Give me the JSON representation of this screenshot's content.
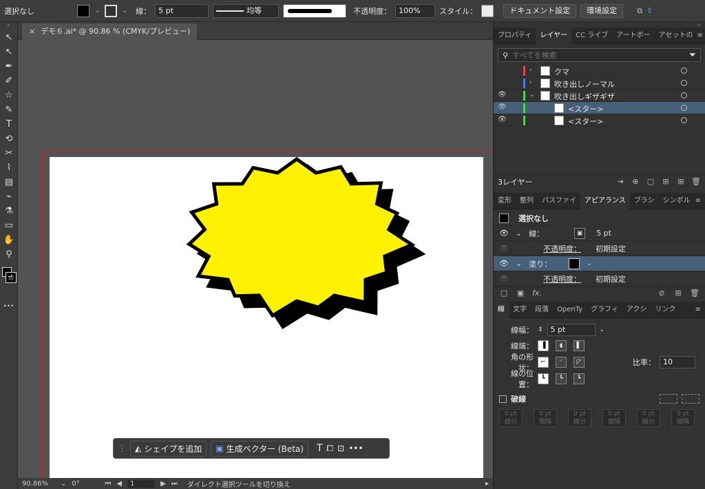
{
  "control_bar": {
    "selection": "選択なし",
    "stroke_label": "線：",
    "stroke_weight": "5 pt",
    "profile": "均等",
    "opacity_label": "不透明度：",
    "opacity": "100%",
    "style_label": "スタイル：",
    "doc_settings": "ドキュメント設定",
    "env_settings": "環境設定"
  },
  "document_tab": {
    "close": "×",
    "title": "デモ６.ai* @ 90.86 % (CMYK/プレビュー)"
  },
  "toolbar": {
    "icons": [
      "selection-tool-icon",
      "direct-selection-tool-icon",
      "pen-tool-icon",
      "curvature-tool-icon",
      "star-tool-icon",
      "paintbrush-tool-icon",
      "type-tool-icon",
      "rotate-tool-icon",
      "scissors-tool-icon",
      "warp-tool-icon",
      "gradient-tool-icon",
      "eyedropper-tool-icon",
      "symbol-sprayer-icon",
      "artboard-tool-icon",
      "hand-tool-icon",
      "zoom-tool-icon"
    ],
    "glyphs": [
      "↖",
      "↖",
      "✒",
      "✐",
      "☆",
      "✎",
      "T",
      "⟲",
      "✂",
      "⌇",
      "▤",
      "⌁",
      "⚗",
      "▭",
      "✋",
      "⚲"
    ],
    "more": "•••"
  },
  "contextual_task_bar": {
    "add_shape": "シェイプを追加",
    "gen_vector": "生成ベクター (Beta)"
  },
  "status_bar": {
    "zoom": "90.86%",
    "rotation": "0°",
    "artboard": "1",
    "message": "ダイレクト選択ツールを切り換え"
  },
  "layers_panel": {
    "tabs": [
      "プロパティ",
      "レイヤー",
      "CC ライブ",
      "アートボー",
      "アセットの"
    ],
    "active_tab": 1,
    "search_placeholder": "すべてを検索",
    "rows": [
      {
        "name": "クマ",
        "visible": false,
        "color": "#e0474c",
        "indent": 0,
        "chevron": "›",
        "selected": false
      },
      {
        "name": "吹き出しノーマル",
        "visible": false,
        "color": "#4f7bd6",
        "indent": 0,
        "chevron": "›",
        "selected": false
      },
      {
        "name": "吹き出しギザギザ",
        "visible": true,
        "color": "#4fd14f",
        "indent": 0,
        "chevron": "⌄",
        "selected": false
      },
      {
        "name": "<スター>",
        "visible": true,
        "color": "#4fd14f",
        "indent": 1,
        "chevron": "",
        "selected": true
      },
      {
        "name": "<スター>",
        "visible": true,
        "color": "#4fd14f",
        "indent": 1,
        "chevron": "",
        "selected": false
      }
    ],
    "count_label": "3レイヤー"
  },
  "appearance_panel": {
    "tabs": [
      "変形",
      "整列",
      "パスファイ",
      "アピアランス",
      "ブラシ",
      "シンボル"
    ],
    "active_tab": 3,
    "header": "選択なし",
    "stroke_label": "線：",
    "stroke_value": "5 pt",
    "opacity_label": "不透明度：",
    "opacity_value": "初期設定",
    "fill_label": "塗り：",
    "fill_opacity_label": "不透明度：",
    "fill_opacity_value": "初期設定",
    "fx": "fx."
  },
  "stroke_panel": {
    "tabs": [
      "線",
      "文字",
      "段落",
      "OpenTy",
      "グラフィ",
      "アクシ",
      "リンク"
    ],
    "active_tab": 0,
    "weight_label": "線幅：",
    "weight_value": "5 pt",
    "cap_label": "線端：",
    "corner_label": "角の形状：",
    "align_label": "線の位置：",
    "limit_label": "比率：",
    "limit_value": "10",
    "dashed_label": "破線",
    "dash_cells": [
      {
        "value": "0 pt",
        "label": "線分"
      },
      {
        "value": "0 pt",
        "label": "間隔"
      },
      {
        "value": "0 pt",
        "label": "線分"
      },
      {
        "value": "0 pt",
        "label": "間隔"
      },
      {
        "value": "0 pt",
        "label": "線分"
      },
      {
        "value": "0 pt",
        "label": "間隔"
      }
    ]
  },
  "colors": {
    "star_fill": "#fff200",
    "star_shadow": "#000000",
    "artboard_border": "#c8221e"
  }
}
